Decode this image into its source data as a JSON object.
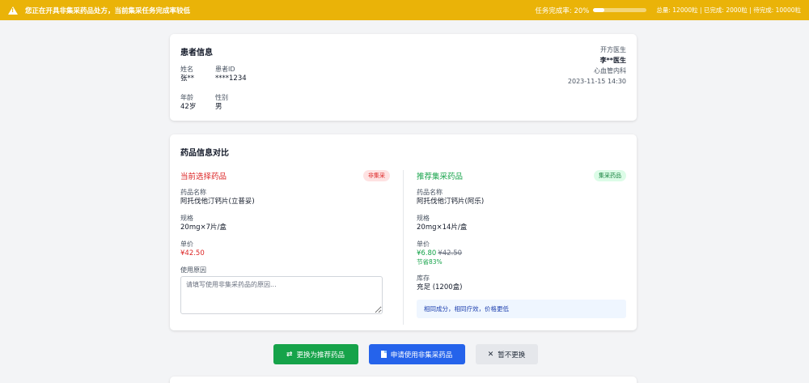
{
  "banner": {
    "message": "您正在开具非集采药品处方，当前集采任务完成率较低",
    "progress_label": "任务完成率: 20%",
    "progress_fraction": 0.2,
    "stats": "总量: 12000粒 | 已完成: 2000粒 | 待完成: 10000粒"
  },
  "patient": {
    "title": "患者信息",
    "name_label": "姓名",
    "name_value": "张**",
    "id_label": "患者ID",
    "id_value": "****1234",
    "age_label": "年龄",
    "age_value": "42岁",
    "gender_label": "性别",
    "gender_value": "男",
    "doctor": {
      "label": "开方医生",
      "name": "李**医生",
      "department": "心血管内科",
      "datetime": "2023-11-15 14:30"
    }
  },
  "compare": {
    "title": "药品信息对比",
    "current": {
      "title": "当前选择药品",
      "badge": "非集采",
      "drug_label": "药品名称",
      "drug_name": "阿托伐他汀钙片(立普妥)",
      "spec_label": "规格",
      "spec": "20mg×7片/盒",
      "price_label": "单价",
      "price": "¥42.50",
      "reason_label": "使用原因",
      "reason_placeholder": "请填写使用非集采药品的原因..."
    },
    "recommended": {
      "title": "推荐集采药品",
      "badge": "集采药品",
      "drug_label": "药品名称",
      "drug_name": "阿托伐他汀钙片(阿乐)",
      "spec_label": "规格",
      "spec": "20mg×14片/盒",
      "price_label": "单价",
      "price": "¥6.80",
      "old_price": "¥42.50",
      "saving": "节省83%",
      "stock_label": "库存",
      "stock": "充足 (1200盒)",
      "note": "相同成分，相同疗效，价格更低"
    }
  },
  "actions": {
    "replace": "更换为推荐药品",
    "apply": "申请使用非集采药品",
    "skip": "暂不更换"
  },
  "colors": {
    "banner": "#eab308",
    "green": "#16a34a",
    "blue": "#2563eb",
    "red": "#dc2626"
  }
}
